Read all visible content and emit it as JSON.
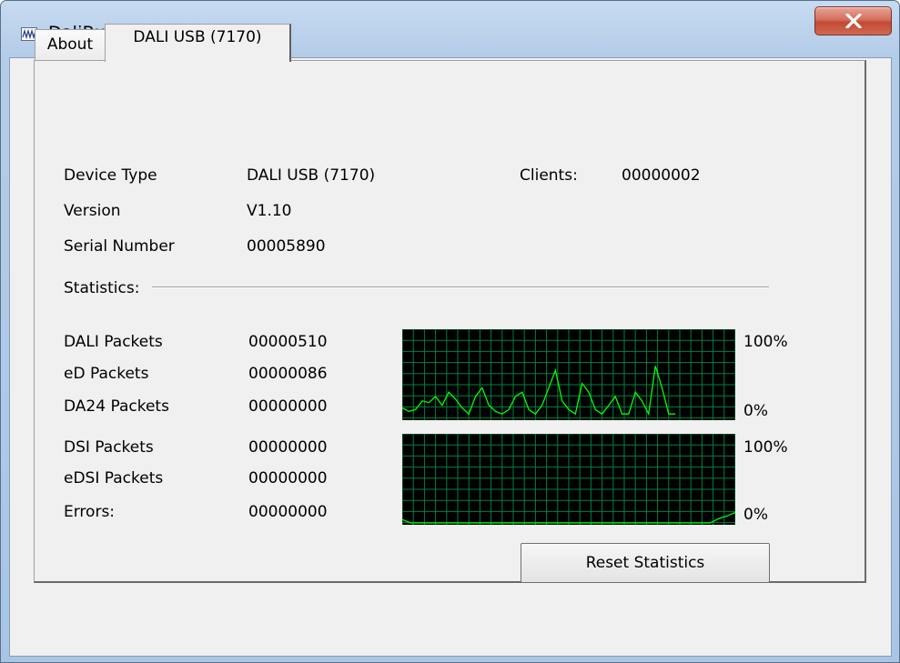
{
  "window": {
    "title": "DaliBusServer"
  },
  "tabs": [
    {
      "label": "About"
    },
    {
      "label": "DALI USB (7170)"
    }
  ],
  "device": {
    "type_label": "Device Type",
    "type_value": "DALI USB (7170)",
    "clients_label": "Clients:",
    "clients_value": "00000002",
    "version_label": "Version",
    "version_value": "V1.10",
    "serial_label": "Serial Number",
    "serial_value": "00005890"
  },
  "statistics": {
    "label": "Statistics:",
    "rows": [
      {
        "label": "DALI Packets",
        "value": "00000510"
      },
      {
        "label": "eD Packets",
        "value": "00000086"
      },
      {
        "label": "DA24 Packets",
        "value": "00000000"
      },
      {
        "label": "DSI Packets",
        "value": "00000000"
      },
      {
        "label": "eDSI Packets",
        "value": "00000000"
      },
      {
        "label": "Errors:",
        "value": "00000000"
      }
    ],
    "graph1": {
      "max_label": "100%",
      "min_label": "0%",
      "levels": [
        0.12,
        0.08,
        0.1,
        0.2,
        0.18,
        0.25,
        0.15,
        0.3,
        0.22,
        0.12,
        0.05,
        0.25,
        0.35,
        0.15,
        0.08,
        0.05,
        0.1,
        0.25,
        0.3,
        0.1,
        0.05,
        0.15,
        0.35,
        0.55,
        0.2,
        0.1,
        0.05,
        0.4,
        0.3,
        0.1,
        0.05,
        0.15,
        0.25,
        0.05,
        0.05,
        0.3,
        0.2,
        0.05,
        0.6,
        0.35,
        0.05,
        0.05
      ]
    },
    "graph2": {
      "max_label": "100%",
      "min_label": "0%",
      "levels": [
        0.04,
        0,
        0,
        0,
        0,
        0,
        0,
        0,
        0,
        0,
        0,
        0,
        0,
        0,
        0,
        0,
        0,
        0,
        0,
        0,
        0,
        0,
        0,
        0,
        0,
        0,
        0,
        0,
        0,
        0,
        0,
        0,
        0,
        0,
        0,
        0,
        0,
        0,
        0.05,
        0.08,
        0.12
      ]
    }
  },
  "buttons": {
    "reset": "Reset Statistics"
  },
  "colors": {
    "graph_bg": "#000000",
    "graph_grid": "#008040",
    "graph_line": "#00ff00"
  }
}
